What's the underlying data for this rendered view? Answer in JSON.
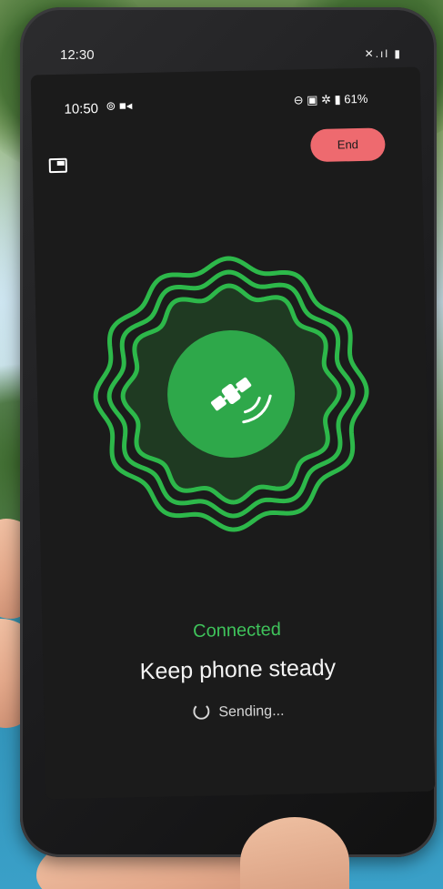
{
  "outer_status": {
    "time": "12:30",
    "icons": "✕.ıl ▮"
  },
  "inner_status": {
    "time": "10:50",
    "left_icons": "⊚ ■◂",
    "right_icons": "⊖ ▣ ✲ ▮",
    "battery": "61%"
  },
  "end_button": {
    "label": "End"
  },
  "icons": {
    "pip": "picture-in-picture-icon",
    "satellite": "satellite-icon",
    "spinner": "loading-spinner-icon"
  },
  "status": {
    "connected": "Connected",
    "instruction": "Keep phone steady",
    "sending": "Sending..."
  },
  "colors": {
    "accent_green": "#3fc35b",
    "end_red": "#ee6a6f",
    "screen_bg": "#1b1b1b"
  }
}
